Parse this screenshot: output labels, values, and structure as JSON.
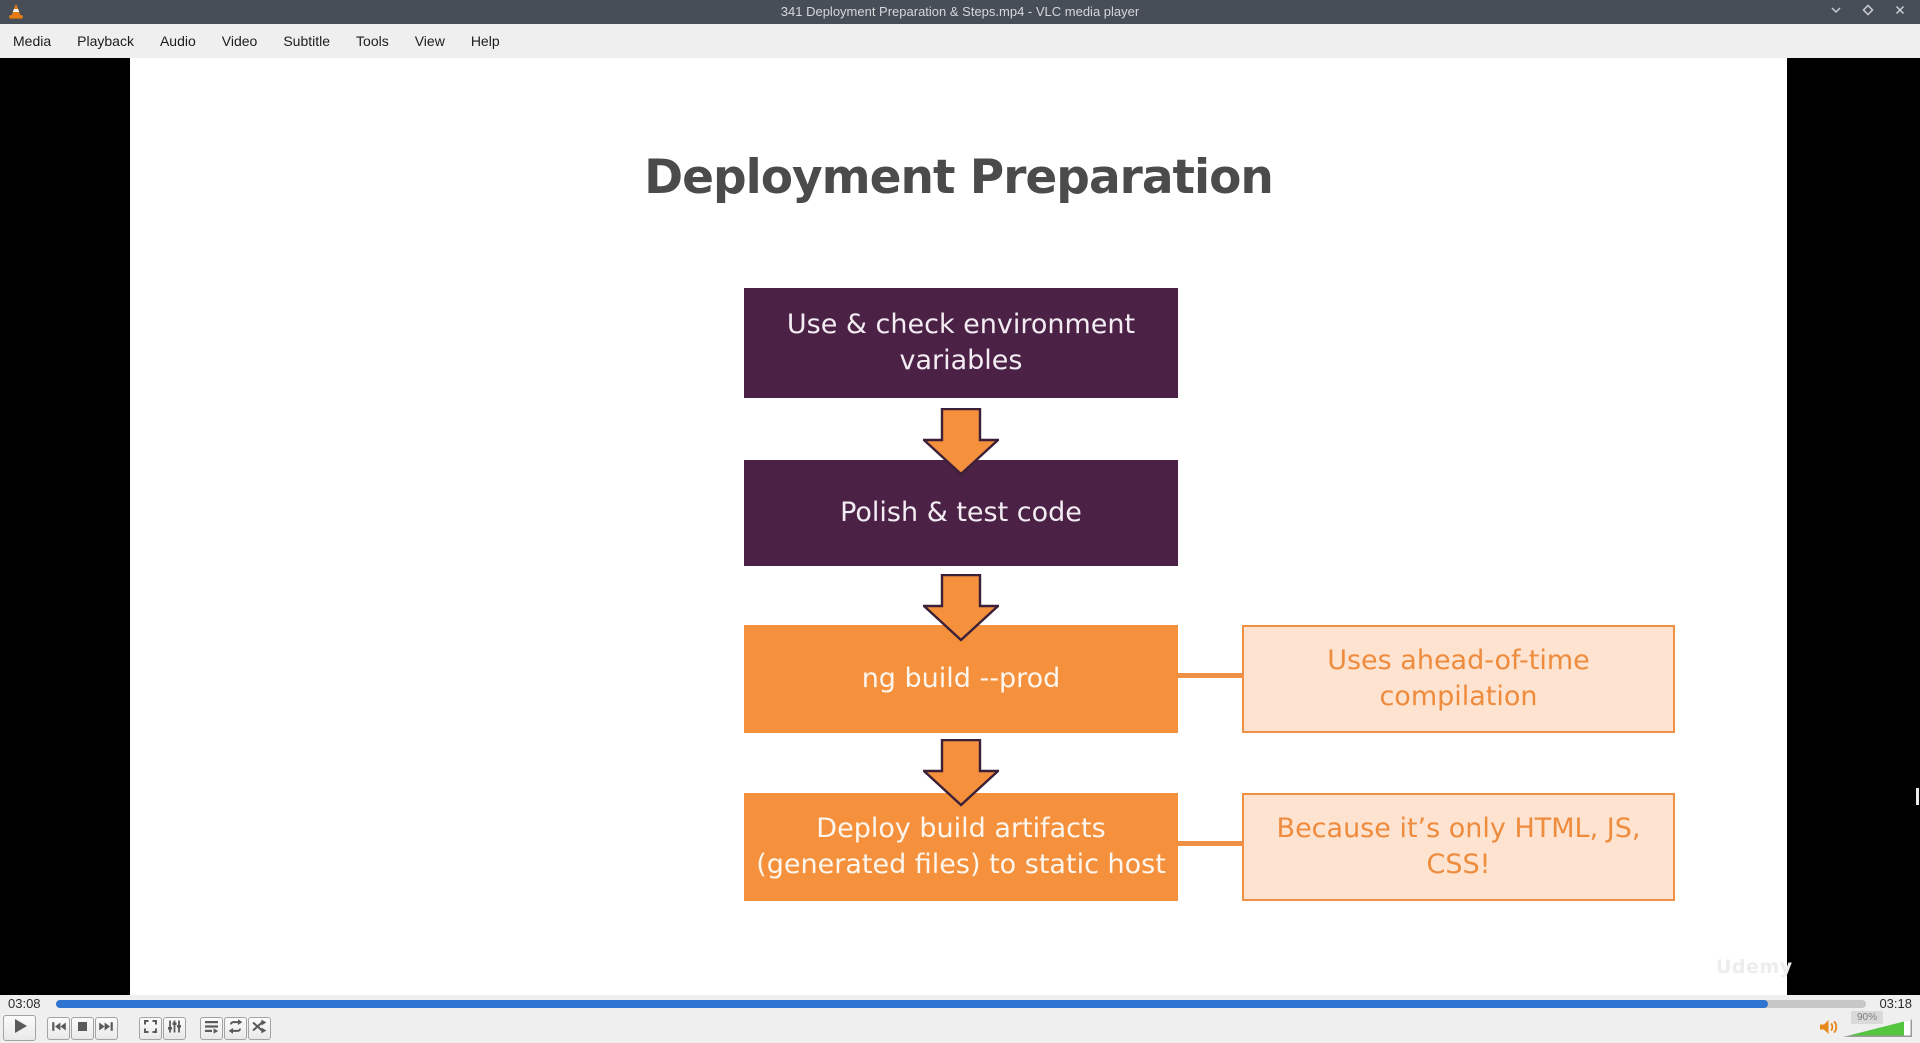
{
  "window": {
    "title": "341 Deployment Preparation & Steps.mp4 - VLC media player"
  },
  "menu": {
    "items": [
      "Media",
      "Playback",
      "Audio",
      "Video",
      "Subtitle",
      "Tools",
      "View",
      "Help"
    ]
  },
  "slide": {
    "title": "Deployment Preparation",
    "flow": [
      {
        "label": "Use & check environment\nvariables",
        "style": "purple"
      },
      {
        "label": "Polish & test code",
        "style": "purple"
      },
      {
        "label": "ng build --prod",
        "style": "orange",
        "note": "Uses ahead-of-time\ncompilation"
      },
      {
        "label": "Deploy build artifacts\n(generated files) to static host",
        "style": "orange",
        "note": "Because it’s only HTML, JS,\nCSS!"
      }
    ],
    "watermark": "Udemy"
  },
  "playback": {
    "elapsed": "03:08",
    "total": "03:18",
    "progress_percent": 94.6,
    "volume_percent": 90,
    "volume_label": "90%"
  },
  "icons": {
    "titlebar": [
      "vlc-cone-icon",
      "minimize-icon",
      "maximize-icon",
      "close-icon"
    ],
    "controls": [
      "play-icon",
      "previous-icon",
      "stop-icon",
      "next-icon",
      "fullscreen-icon",
      "extended-settings-icon",
      "playlist-icon",
      "loop-icon",
      "random-icon",
      "volume-icon"
    ],
    "arrow": "down-block-arrow-icon"
  },
  "colors": {
    "titlebar_bg": "#474e57",
    "menubar_bg": "#efefef",
    "seek_fill": "#2e74d1",
    "volume_fill": "#53c53f",
    "box_purple": "#4b2246",
    "box_orange": "#f5913d",
    "callout_bg": "#fde3d0",
    "callout_accent": "#ef8b3d",
    "slide_title_text": "#4b4b4b"
  }
}
